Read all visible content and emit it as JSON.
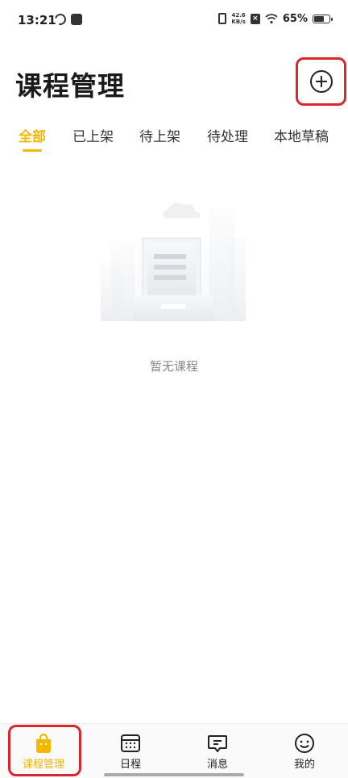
{
  "status_bar": {
    "time": "13:21",
    "net_speed_value": "42.6",
    "net_speed_unit": "KB/s",
    "battery_text": "65%",
    "battery_level": 0.65
  },
  "header": {
    "title": "课程管理",
    "add_icon": "plus-circle-icon"
  },
  "tabs": [
    {
      "label": "全部",
      "active": true
    },
    {
      "label": "已上架",
      "active": false
    },
    {
      "label": "待上架",
      "active": false
    },
    {
      "label": "待处理",
      "active": false
    },
    {
      "label": "本地草稿",
      "active": false
    }
  ],
  "empty_state": {
    "text": "暂无课程",
    "illustration": "empty-document-illustration"
  },
  "bottom_nav": [
    {
      "label": "课程管理",
      "icon": "shopping-bag-icon",
      "active": true
    },
    {
      "label": "日程",
      "icon": "calendar-icon",
      "active": false
    },
    {
      "label": "消息",
      "icon": "message-icon",
      "active": false
    },
    {
      "label": "我的",
      "icon": "smiley-icon",
      "active": false
    }
  ],
  "colors": {
    "accent": "#f5b800",
    "highlight_box": "#d9272e"
  }
}
